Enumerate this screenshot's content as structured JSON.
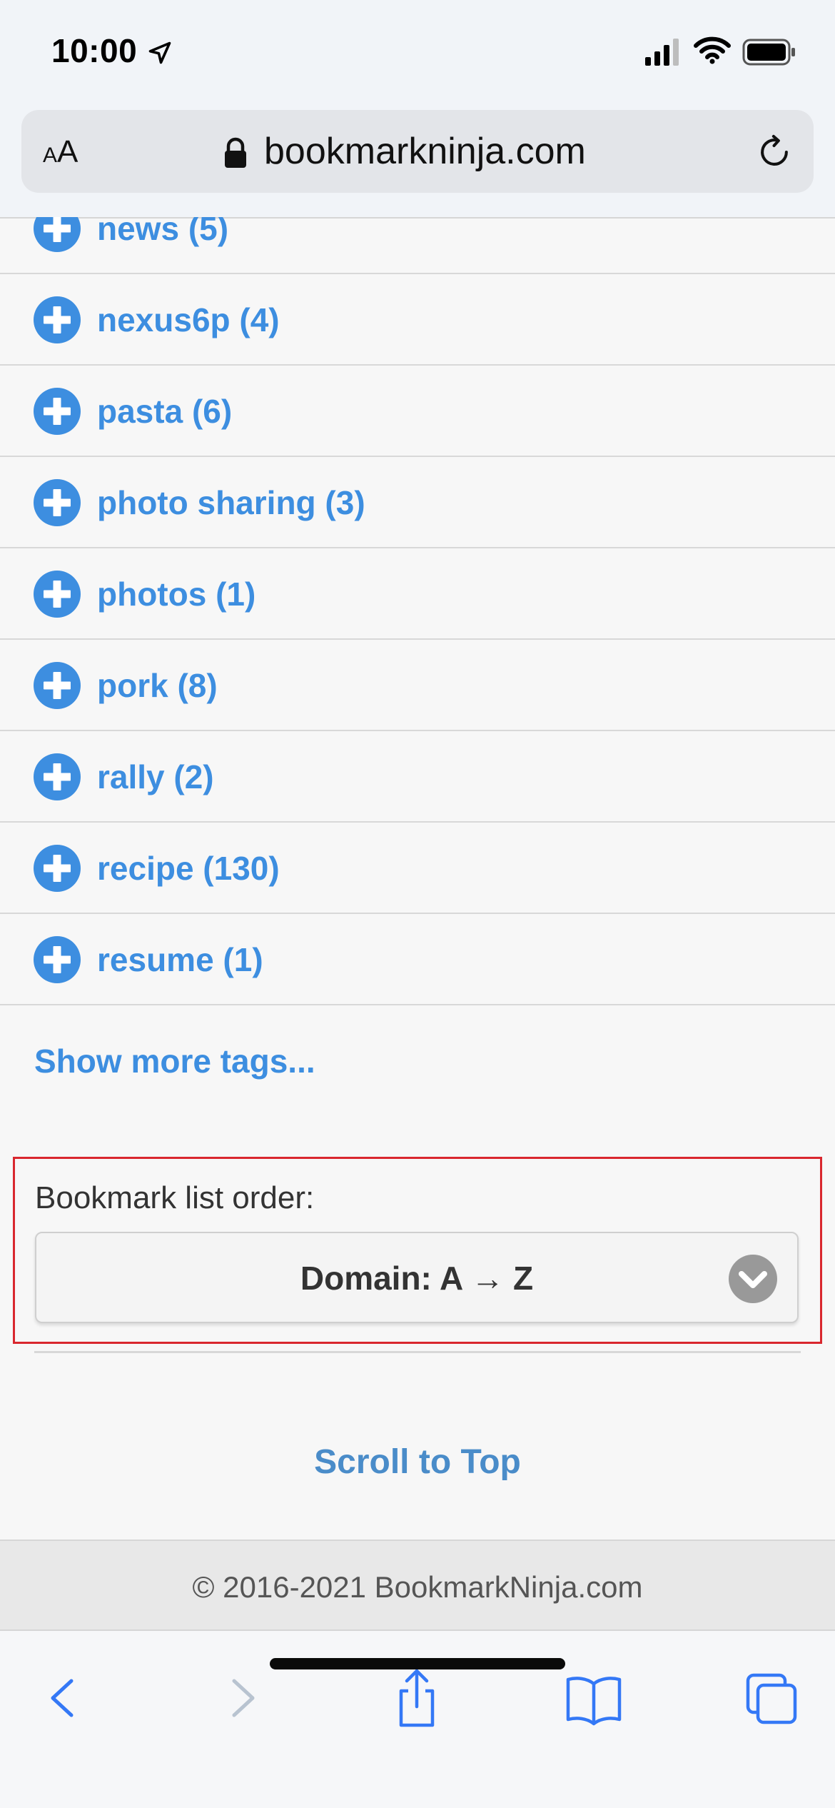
{
  "status_bar": {
    "time": "10:00",
    "icons": [
      "location-arrow-icon",
      "cellular-signal-icon",
      "wifi-icon",
      "battery-icon"
    ]
  },
  "browser": {
    "text_size_button": {
      "small": "A",
      "large": "A"
    },
    "url": "bookmarkninja.com",
    "icons": [
      "lock-icon",
      "reload-icon"
    ]
  },
  "tags": {
    "icon": "plus-circle-icon",
    "accent_color": "#3d8ee0",
    "items": [
      {
        "label": "news (5)"
      },
      {
        "label": "nexus6p (4)"
      },
      {
        "label": "pasta (6)"
      },
      {
        "label": "photo sharing (3)"
      },
      {
        "label": "photos (1)"
      },
      {
        "label": "pork (8)"
      },
      {
        "label": "rally (2)"
      },
      {
        "label": "recipe (130)"
      },
      {
        "label": "resume (1)"
      }
    ],
    "show_more": "Show more tags..."
  },
  "order": {
    "label": "Bookmark list order:",
    "selected": "Domain: A → Z",
    "highlight_color": "#d9272e",
    "icon": "chevron-down-circle-icon"
  },
  "scroll_to_top": "Scroll to Top",
  "footer": {
    "copyright": "© 2016-2021 BookmarkNinja.com"
  },
  "toolbar": {
    "icons": [
      "back-icon",
      "forward-icon",
      "share-icon",
      "bookmarks-icon",
      "tabs-icon"
    ],
    "color": "#3478f6"
  }
}
